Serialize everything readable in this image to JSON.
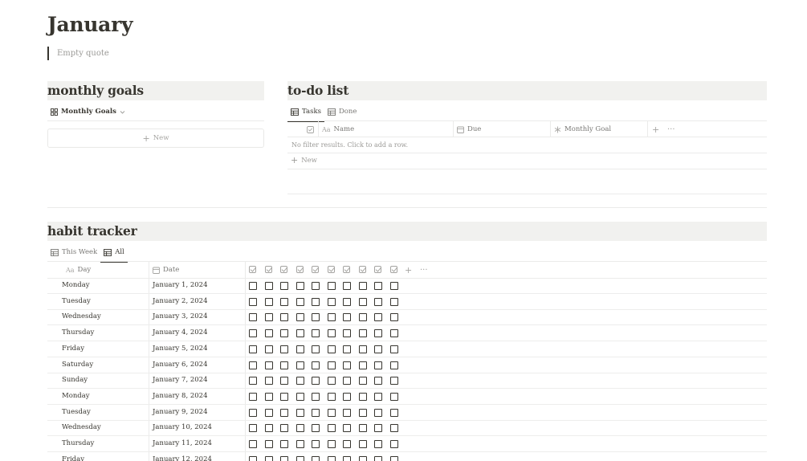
{
  "page": {
    "title": "January",
    "quote": "Empty quote"
  },
  "monthly_goals": {
    "heading": "monthly goals",
    "view_label": "Monthly Goals",
    "new_label": "New"
  },
  "todo": {
    "heading": "to-do list",
    "tabs": [
      "Tasks",
      "Done"
    ],
    "columns": {
      "name": "Name",
      "due": "Due",
      "monthly_goal": "Monthly Goal"
    },
    "empty_message": "No filter results. Click to add a row.",
    "new_label": "New"
  },
  "habit": {
    "heading": "habit tracker",
    "tabs": [
      "This Week",
      "All"
    ],
    "columns": {
      "day": "Day",
      "date": "Date"
    },
    "habit_column_count": 10,
    "rows": [
      {
        "day": "Monday",
        "date": "January 1, 2024"
      },
      {
        "day": "Tuesday",
        "date": "January 2, 2024"
      },
      {
        "day": "Wednesday",
        "date": "January 3, 2024"
      },
      {
        "day": "Thursday",
        "date": "January 4, 2024"
      },
      {
        "day": "Friday",
        "date": "January 5, 2024"
      },
      {
        "day": "Saturday",
        "date": "January 6, 2024"
      },
      {
        "day": "Sunday",
        "date": "January 7, 2024"
      },
      {
        "day": "Monday",
        "date": "January 8, 2024"
      },
      {
        "day": "Tuesday",
        "date": "January 9, 2024"
      },
      {
        "day": "Wednesday",
        "date": "January 10, 2024"
      },
      {
        "day": "Thursday",
        "date": "January 11, 2024"
      },
      {
        "day": "Friday",
        "date": "January 12, 2024"
      }
    ]
  },
  "icons": {
    "table": "table-icon",
    "gallery": "gallery-icon",
    "text_prop": "text-property-icon",
    "calendar": "calendar-icon",
    "relation": "relation-icon",
    "checkbox": "checkbox-icon",
    "plus": "plus-icon",
    "more": "more-icon",
    "chevron": "chevron-down-icon"
  }
}
